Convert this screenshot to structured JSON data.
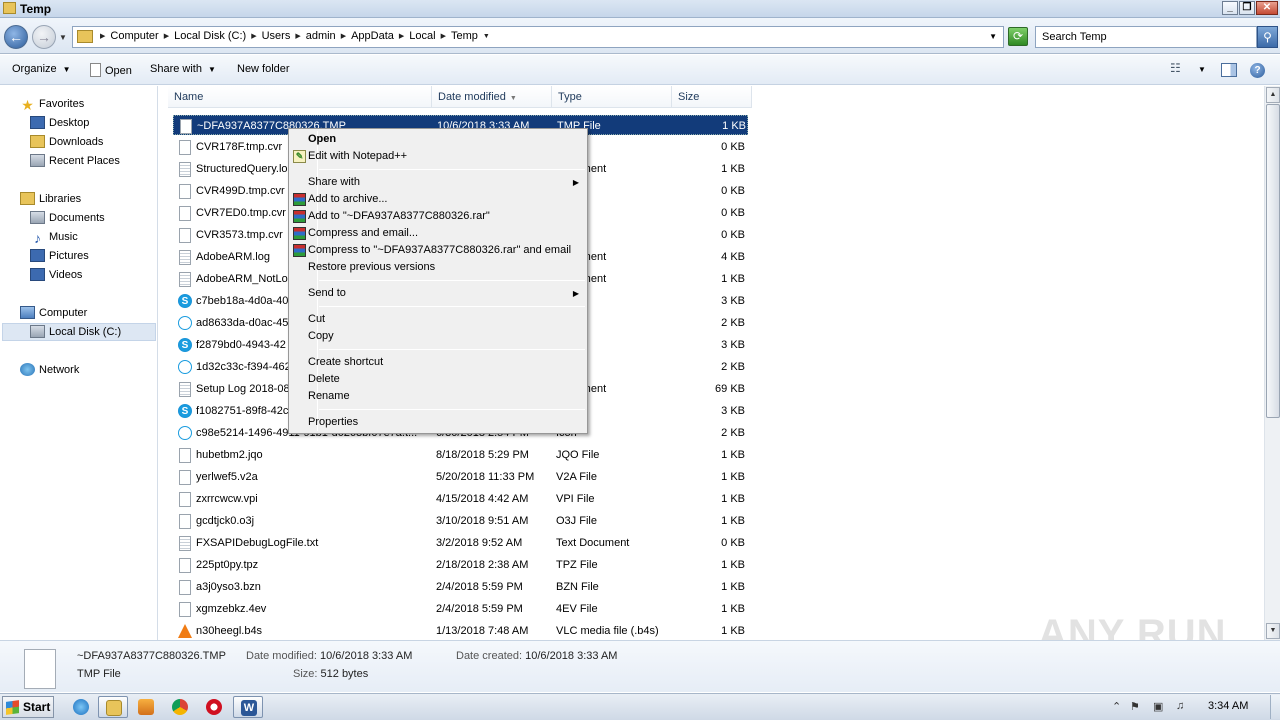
{
  "window": {
    "title": "Temp"
  },
  "address": {
    "crumbs": [
      "Computer",
      "Local Disk (C:)",
      "Users",
      "admin",
      "AppData",
      "Local",
      "Temp"
    ],
    "search_placeholder": "Search Temp"
  },
  "toolbar": {
    "organize": "Organize",
    "open": "Open",
    "share_with": "Share with",
    "new_folder": "New folder"
  },
  "nav": {
    "favorites": "Favorites",
    "desktop": "Desktop",
    "downloads": "Downloads",
    "recent_places": "Recent Places",
    "libraries": "Libraries",
    "documents": "Documents",
    "music": "Music",
    "pictures": "Pictures",
    "videos": "Videos",
    "computer": "Computer",
    "local_disk": "Local Disk (C:)",
    "network": "Network"
  },
  "columns": {
    "name": "Name",
    "date": "Date modified",
    "type": "Type",
    "size": "Size"
  },
  "files": [
    {
      "name": "~DFA937A8377C880326.TMP",
      "date": "10/6/2018 3:33 AM",
      "type": "TMP File",
      "size": "1 KB",
      "icon": "doc"
    },
    {
      "name": "CVR178F.tmp.cvr",
      "date": "",
      "type": "e",
      "size": "0 KB",
      "icon": "doc"
    },
    {
      "name": "StructuredQuery.lo",
      "date": "",
      "type": "Document",
      "size": "1 KB",
      "icon": "txt"
    },
    {
      "name": "CVR499D.tmp.cvr",
      "date": "",
      "type": "e",
      "size": "0 KB",
      "icon": "doc"
    },
    {
      "name": "CVR7ED0.tmp.cvr",
      "date": "",
      "type": "e",
      "size": "0 KB",
      "icon": "doc"
    },
    {
      "name": "CVR3573.tmp.cvr",
      "date": "",
      "type": "e",
      "size": "0 KB",
      "icon": "doc"
    },
    {
      "name": "AdobeARM.log",
      "date": "",
      "type": "Document",
      "size": "4 KB",
      "icon": "txt"
    },
    {
      "name": "AdobeARM_NotLoc",
      "date": "",
      "type": "Document",
      "size": "1 KB",
      "icon": "txt"
    },
    {
      "name": "c7beb18a-4d0a-40",
      "date": "",
      "type": "",
      "size": "3 KB",
      "icon": "skype"
    },
    {
      "name": "ad8633da-d0ac-45",
      "date": "",
      "type": "",
      "size": "2 KB",
      "icon": "ring"
    },
    {
      "name": "f2879bd0-4943-42",
      "date": "",
      "type": "",
      "size": "3 KB",
      "icon": "skype"
    },
    {
      "name": "1d32c33c-f394-462",
      "date": "",
      "type": "",
      "size": "2 KB",
      "icon": "ring"
    },
    {
      "name": "Setup Log 2018-08",
      "date": "",
      "type": "Document",
      "size": "69 KB",
      "icon": "txt"
    },
    {
      "name": "f1082751-89f8-42c",
      "date": "",
      "type": "",
      "size": "3 KB",
      "icon": "skype"
    },
    {
      "name": "c98e5214-1496-4911-91b1-d0263bf07e7a.t...",
      "date": "6/30/2018 2:54 PM",
      "type": "Icon",
      "size": "2 KB",
      "icon": "ring"
    },
    {
      "name": "hubetbm2.jqo",
      "date": "8/18/2018 5:29 PM",
      "type": "JQO File",
      "size": "1 KB",
      "icon": "doc"
    },
    {
      "name": "yerlwef5.v2a",
      "date": "5/20/2018 11:33 PM",
      "type": "V2A File",
      "size": "1 KB",
      "icon": "doc"
    },
    {
      "name": "zxrrcwcw.vpi",
      "date": "4/15/2018 4:42 AM",
      "type": "VPI File",
      "size": "1 KB",
      "icon": "doc"
    },
    {
      "name": "gcdtjck0.o3j",
      "date": "3/10/2018 9:51 AM",
      "type": "O3J File",
      "size": "1 KB",
      "icon": "doc"
    },
    {
      "name": "FXSAPIDebugLogFile.txt",
      "date": "3/2/2018 9:52 AM",
      "type": "Text Document",
      "size": "0 KB",
      "icon": "txt"
    },
    {
      "name": "225pt0py.tpz",
      "date": "2/18/2018 2:38 AM",
      "type": "TPZ File",
      "size": "1 KB",
      "icon": "doc"
    },
    {
      "name": "a3j0yso3.bzn",
      "date": "2/4/2018 5:59 PM",
      "type": "BZN File",
      "size": "1 KB",
      "icon": "doc"
    },
    {
      "name": "xgmzebkz.4ev",
      "date": "2/4/2018 5:59 PM",
      "type": "4EV File",
      "size": "1 KB",
      "icon": "doc"
    },
    {
      "name": "n30heegl.b4s",
      "date": "1/13/2018 7:48 AM",
      "type": "VLC media file (.b4s)",
      "size": "1 KB",
      "icon": "vlc"
    }
  ],
  "context_menu": {
    "open": "Open",
    "edit_npp": "Edit with Notepad++",
    "share_with": "Share with",
    "add_archive": "Add to archive...",
    "add_to_rar": "Add to \"~DFA937A8377C880326.rar\"",
    "compress_email": "Compress and email...",
    "compress_rar_email": "Compress to \"~DFA937A8377C880326.rar\" and email",
    "restore": "Restore previous versions",
    "send_to": "Send to",
    "cut": "Cut",
    "copy": "Copy",
    "create_shortcut": "Create shortcut",
    "delete": "Delete",
    "rename": "Rename",
    "properties": "Properties"
  },
  "details": {
    "filename": "~DFA937A8377C880326.TMP",
    "filetype": "TMP File",
    "date_modified_label": "Date modified:",
    "date_modified": "10/6/2018 3:33 AM",
    "date_created_label": "Date created:",
    "date_created": "10/6/2018 3:33 AM",
    "size_label": "Size:",
    "size": "512 bytes"
  },
  "taskbar": {
    "start": "Start",
    "clock": "3:34 AM"
  },
  "watermark": "ANY RUN"
}
